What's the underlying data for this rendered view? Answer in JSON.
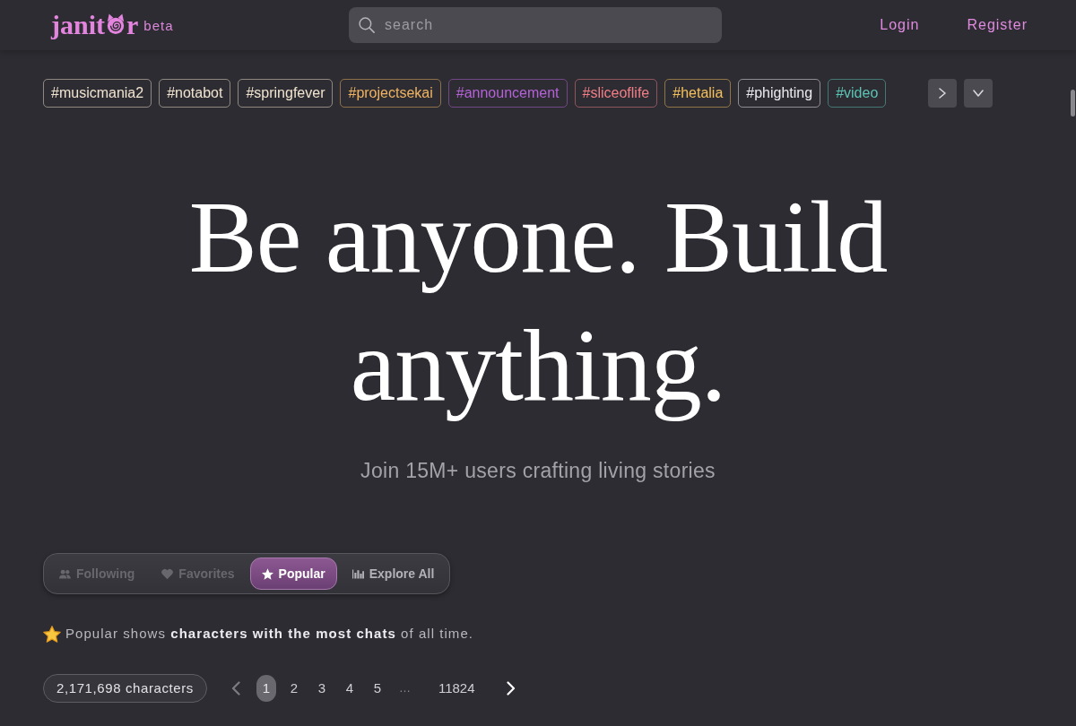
{
  "header": {
    "logo": {
      "text_before_icon": "janit",
      "text_after_icon": "r"
    },
    "badge": "beta",
    "search": {
      "placeholder": "search"
    },
    "links": [
      "Login",
      "Register"
    ]
  },
  "tags": [
    {
      "label": "#musicmania2",
      "color": "#f1e4d0"
    },
    {
      "label": "#notabot",
      "color": "#f1e4d0"
    },
    {
      "label": "#springfever",
      "color": "#f1e4d0"
    },
    {
      "label": "#projectsekai",
      "color": "#f0b462"
    },
    {
      "label": "#announcement",
      "color": "#b562d8"
    },
    {
      "label": "#sliceoflife",
      "color": "#f27e88"
    },
    {
      "label": "#hetalia",
      "color": "#f4c05c"
    },
    {
      "label": "#phighting",
      "color": "#ececf0"
    },
    {
      "label": "#video",
      "color": "#5cc4b4"
    }
  ],
  "hero": {
    "title": "Be anyone. Build anything.",
    "subtitle": "Join 15M+ users crafting living stories"
  },
  "tabs": [
    {
      "label": "Following",
      "selected": false,
      "disabled": true
    },
    {
      "label": "Favorites",
      "selected": false,
      "disabled": true
    },
    {
      "label": "Popular",
      "selected": true,
      "disabled": false
    },
    {
      "label": "Explore All",
      "selected": false,
      "disabled": false
    }
  ],
  "info": "Popular shows **characters with the most chats** of all time.",
  "pagination": {
    "count": "2,171,698 characters",
    "prev": {
      "disabled": true
    },
    "next": {
      "disabled": false
    },
    "pages": [
      {
        "kind": "page",
        "label": "1",
        "selected": true
      },
      {
        "kind": "page",
        "label": "2",
        "selected": false
      },
      {
        "kind": "page",
        "label": "3",
        "selected": false
      },
      {
        "kind": "page",
        "label": "4",
        "selected": false
      },
      {
        "kind": "page",
        "label": "5",
        "selected": false
      },
      {
        "kind": "gap",
        "label": "…"
      },
      {
        "kind": "page",
        "label": "11824",
        "selected": false
      }
    ]
  }
}
